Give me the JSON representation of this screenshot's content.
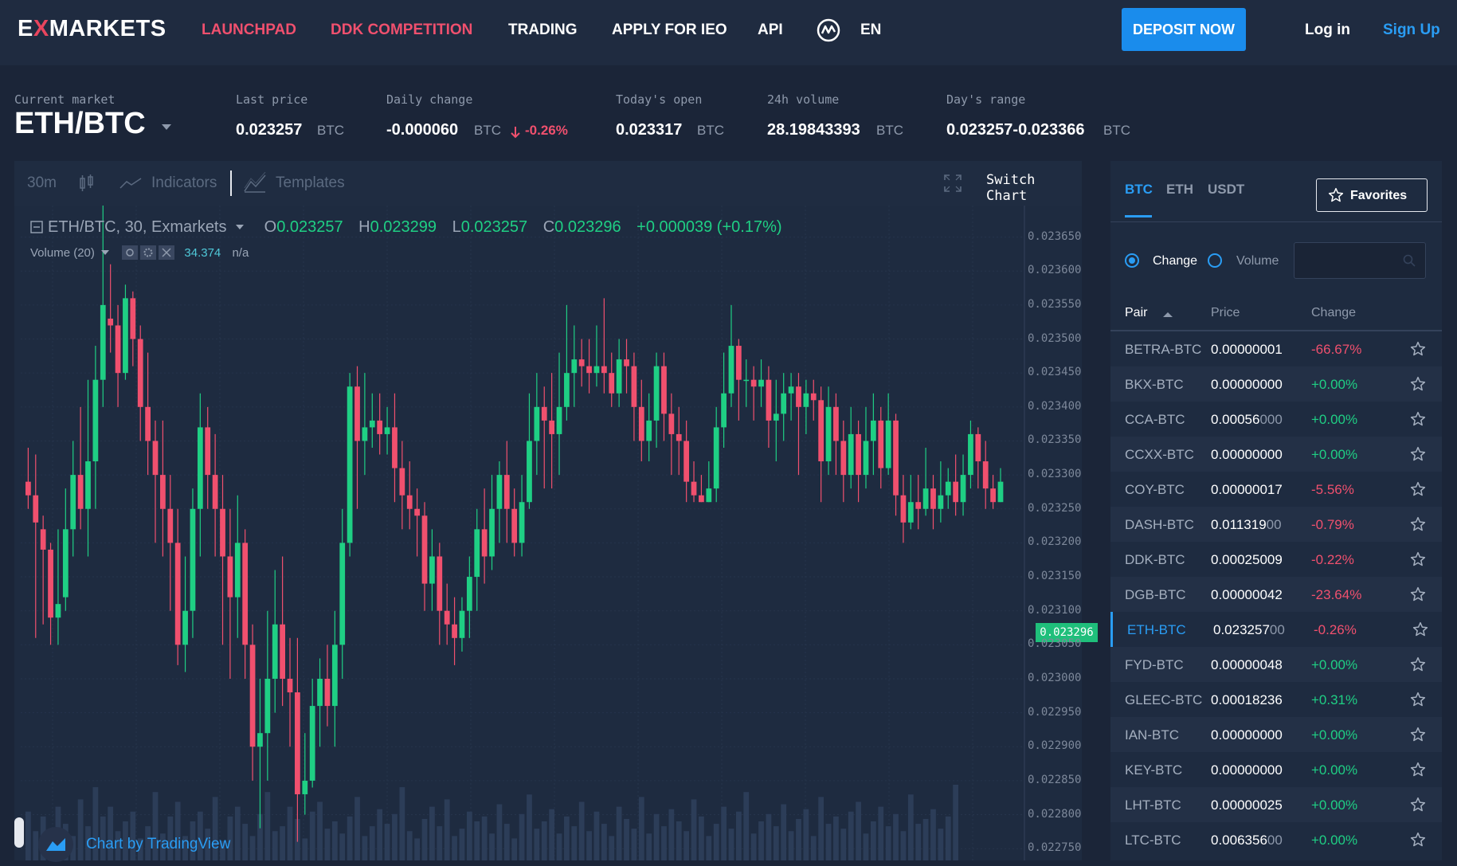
{
  "nav": {
    "logo_pre": "E",
    "logo_x": "X",
    "logo_post": "MARKETS",
    "launchpad": "LAUNCHPAD",
    "ddk": "DDK COMPETITION",
    "trading": "TRADING",
    "ieo": "APPLY FOR IEO",
    "api": "API",
    "lang": "EN",
    "deposit": "DEPOSIT NOW",
    "login": "Log in",
    "signup": "Sign Up"
  },
  "market": {
    "current_label": "Current market",
    "pair": "ETH/BTC",
    "last_price_label": "Last price",
    "last_price": "0.023257",
    "last_price_unit": "BTC",
    "daily_change_label": "Daily change",
    "daily_change": "-0.000060",
    "daily_change_unit": "BTC",
    "daily_change_pct": "-0.26%",
    "open_label": "Today's open",
    "open": "0.023317",
    "open_unit": "BTC",
    "volume_label": "24h volume",
    "volume": "28.19843393",
    "volume_unit": "BTC",
    "range_label": "Day's range",
    "range": "0.023257-0.023366",
    "range_unit": "BTC"
  },
  "toolbar": {
    "interval": "30m",
    "indicators": "Indicators",
    "templates": "Templates",
    "switch_chart": "Switch Chart"
  },
  "legend": {
    "title": "ETH/BTC, 30, Exmarkets",
    "o_label": "O",
    "o": "0.023257",
    "h_label": "H",
    "h": "0.023299",
    "l_label": "L",
    "l": "0.023257",
    "c_label": "C",
    "c": "0.023296",
    "change": "+0.000039 (+0.17%)",
    "volume_label": "Volume (20)",
    "volume_value": "34.374",
    "volume_na": "n/a",
    "last_tag": "0.023296",
    "tv_text": "Chart by TradingView"
  },
  "chart_data": {
    "type": "candlestick",
    "yticks": [
      "0.023650",
      "0.023600",
      "0.023550",
      "0.023500",
      "0.023450",
      "0.023400",
      "0.023350",
      "0.023300",
      "0.023250",
      "0.023200",
      "0.023150",
      "0.023100",
      "0.023050",
      "0.023000",
      "0.022950",
      "0.022900",
      "0.022850",
      "0.022800",
      "0.022750"
    ],
    "ylim": [
      0.022735,
      0.02368
    ],
    "candles": [
      [
        0.02329,
        0.02327,
        0.02334,
        0.02325
      ],
      [
        0.02327,
        0.02323,
        0.02333,
        0.02306
      ],
      [
        0.02322,
        0.02319,
        0.02324,
        0.02308
      ],
      [
        0.02319,
        0.02309,
        0.0232,
        0.02305
      ],
      [
        0.02309,
        0.02311,
        0.02322,
        0.02305
      ],
      [
        0.02312,
        0.02322,
        0.02328,
        0.0231
      ],
      [
        0.02322,
        0.0233,
        0.02335,
        0.02318
      ],
      [
        0.0233,
        0.02325,
        0.0234,
        0.02322
      ],
      [
        0.02325,
        0.02332,
        0.02344,
        0.02318
      ],
      [
        0.02332,
        0.02344,
        0.02349,
        0.02325
      ],
      [
        0.02344,
        0.02355,
        0.02562,
        0.0234
      ],
      [
        0.02353,
        0.02352,
        0.02361,
        0.02348
      ],
      [
        0.02352,
        0.02345,
        0.02355,
        0.0234
      ],
      [
        0.02345,
        0.02356,
        0.02358,
        0.02344
      ],
      [
        0.02356,
        0.0235,
        0.02357,
        0.02346
      ],
      [
        0.0235,
        0.0234,
        0.02352,
        0.02335
      ],
      [
        0.0234,
        0.02335,
        0.02348,
        0.0233
      ],
      [
        0.02335,
        0.0233,
        0.02338,
        0.0232
      ],
      [
        0.0233,
        0.02325,
        0.02338,
        0.02318
      ],
      [
        0.02325,
        0.0232,
        0.0233,
        0.0231
      ],
      [
        0.0232,
        0.02305,
        0.02325,
        0.02302
      ],
      [
        0.02305,
        0.0231,
        0.02318,
        0.02301
      ],
      [
        0.0231,
        0.02325,
        0.02328,
        0.02306
      ],
      [
        0.02325,
        0.02337,
        0.02342,
        0.02318
      ],
      [
        0.02337,
        0.0233,
        0.0234,
        0.02325
      ],
      [
        0.0233,
        0.02325,
        0.02336,
        0.02318
      ],
      [
        0.02325,
        0.02318,
        0.0233,
        0.02305
      ],
      [
        0.02318,
        0.02312,
        0.02325,
        0.023
      ],
      [
        0.02312,
        0.0232,
        0.02327,
        0.02306
      ],
      [
        0.0232,
        0.02305,
        0.02322,
        0.023
      ],
      [
        0.02305,
        0.0229,
        0.02308,
        0.02285
      ],
      [
        0.0229,
        0.02292,
        0.023,
        0.02278
      ],
      [
        0.02292,
        0.023,
        0.0231,
        0.02285
      ],
      [
        0.023,
        0.02308,
        0.02316,
        0.02295
      ],
      [
        0.02308,
        0.023,
        0.02318,
        0.02296
      ],
      [
        0.023,
        0.02298,
        0.02306,
        0.0229
      ],
      [
        0.02298,
        0.02283,
        0.02306,
        0.02276
      ],
      [
        0.02283,
        0.02285,
        0.02292,
        0.0228
      ],
      [
        0.02285,
        0.02296,
        0.023,
        0.02284
      ],
      [
        0.02296,
        0.023,
        0.02303,
        0.0229
      ],
      [
        0.023,
        0.02296,
        0.02305,
        0.02293
      ],
      [
        0.02296,
        0.02305,
        0.0231,
        0.0229
      ],
      [
        0.02305,
        0.0232,
        0.02325,
        0.023
      ],
      [
        0.0232,
        0.02343,
        0.02345,
        0.02318
      ],
      [
        0.02343,
        0.02335,
        0.02346,
        0.02325
      ],
      [
        0.02335,
        0.02337,
        0.02345,
        0.0233
      ],
      [
        0.02337,
        0.02338,
        0.02342,
        0.02334
      ],
      [
        0.02338,
        0.02336,
        0.02342,
        0.02333
      ],
      [
        0.02336,
        0.02337,
        0.0234,
        0.02333
      ],
      [
        0.02337,
        0.02331,
        0.02342,
        0.02326
      ],
      [
        0.02331,
        0.02327,
        0.02335,
        0.02322
      ],
      [
        0.02327,
        0.02325,
        0.02332,
        0.02322
      ],
      [
        0.02325,
        0.02324,
        0.02328,
        0.02318
      ],
      [
        0.02324,
        0.02314,
        0.02326,
        0.0231
      ],
      [
        0.02314,
        0.02318,
        0.02322,
        0.0231
      ],
      [
        0.02318,
        0.0231,
        0.0232,
        0.02305
      ],
      [
        0.0231,
        0.02308,
        0.02314,
        0.02305
      ],
      [
        0.02308,
        0.02306,
        0.02312,
        0.02302
      ],
      [
        0.02306,
        0.0231,
        0.02312,
        0.02304
      ],
      [
        0.0231,
        0.02315,
        0.02318,
        0.02306
      ],
      [
        0.02315,
        0.02322,
        0.02325,
        0.0231
      ],
      [
        0.02322,
        0.02318,
        0.02328,
        0.02314
      ],
      [
        0.02318,
        0.02325,
        0.0233,
        0.02316
      ],
      [
        0.02325,
        0.0233,
        0.02332,
        0.0232
      ],
      [
        0.0233,
        0.02325,
        0.02335,
        0.0232
      ],
      [
        0.02325,
        0.0232,
        0.02328,
        0.02318
      ],
      [
        0.0232,
        0.02326,
        0.0233,
        0.02318
      ],
      [
        0.02326,
        0.02335,
        0.02342,
        0.02325
      ],
      [
        0.02335,
        0.0234,
        0.02345,
        0.0233
      ],
      [
        0.0234,
        0.02338,
        0.02343,
        0.02328
      ],
      [
        0.02338,
        0.02336,
        0.02345,
        0.02328
      ],
      [
        0.02336,
        0.0234,
        0.02348,
        0.0233
      ],
      [
        0.0234,
        0.02345,
        0.02355,
        0.02338
      ],
      [
        0.02345,
        0.02347,
        0.02352,
        0.0234
      ],
      [
        0.02347,
        0.02346,
        0.0235,
        0.02343
      ],
      [
        0.02346,
        0.02345,
        0.0235,
        0.02342
      ],
      [
        0.02345,
        0.02346,
        0.02352,
        0.02343
      ],
      [
        0.02346,
        0.02345,
        0.02356,
        0.02342
      ],
      [
        0.02345,
        0.02342,
        0.02348,
        0.0234
      ],
      [
        0.02342,
        0.02347,
        0.0235,
        0.0234
      ],
      [
        0.02347,
        0.02346,
        0.0235,
        0.02342
      ],
      [
        0.02346,
        0.0234,
        0.02348,
        0.02335
      ],
      [
        0.0234,
        0.02335,
        0.02344,
        0.02332
      ],
      [
        0.02335,
        0.02338,
        0.02342,
        0.02332
      ],
      [
        0.02338,
        0.02346,
        0.02348,
        0.02334
      ],
      [
        0.02346,
        0.02339,
        0.02348,
        0.02335
      ],
      [
        0.02339,
        0.02336,
        0.02342,
        0.0233
      ],
      [
        0.02336,
        0.02335,
        0.0234,
        0.0233
      ],
      [
        0.02335,
        0.02329,
        0.02338,
        0.02326
      ],
      [
        0.02329,
        0.02327,
        0.02332,
        0.02326
      ],
      [
        0.02327,
        0.02326,
        0.0233,
        0.02326
      ],
      [
        0.02326,
        0.02328,
        0.02332,
        0.02326
      ],
      [
        0.02328,
        0.02337,
        0.0234,
        0.02326
      ],
      [
        0.02337,
        0.02342,
        0.02348,
        0.02334
      ],
      [
        0.02342,
        0.02349,
        0.02355,
        0.0234
      ],
      [
        0.02349,
        0.02344,
        0.0235,
        0.02338
      ],
      [
        0.02344,
        0.02344,
        0.02347,
        0.0234
      ],
      [
        0.02344,
        0.02343,
        0.02346,
        0.02338
      ],
      [
        0.02343,
        0.02344,
        0.02347,
        0.0234
      ],
      [
        0.02344,
        0.02338,
        0.02346,
        0.02334
      ],
      [
        0.02338,
        0.02339,
        0.02344,
        0.02332
      ],
      [
        0.02339,
        0.02342,
        0.02345,
        0.02335
      ],
      [
        0.02342,
        0.02343,
        0.02345,
        0.02338
      ],
      [
        0.02343,
        0.0234,
        0.02345,
        0.0233
      ],
      [
        0.0234,
        0.02342,
        0.02344,
        0.02336
      ],
      [
        0.02342,
        0.02341,
        0.02344,
        0.02338
      ],
      [
        0.02341,
        0.02332,
        0.02343,
        0.02326
      ],
      [
        0.02332,
        0.0234,
        0.02343,
        0.0233
      ],
      [
        0.0234,
        0.02335,
        0.02342,
        0.0233
      ],
      [
        0.02335,
        0.0233,
        0.02338,
        0.02326
      ],
      [
        0.0233,
        0.02336,
        0.0234,
        0.02328
      ],
      [
        0.02336,
        0.0233,
        0.02338,
        0.02326
      ],
      [
        0.0233,
        0.02335,
        0.0234,
        0.02328
      ],
      [
        0.02335,
        0.02338,
        0.02342,
        0.0233
      ],
      [
        0.02338,
        0.02331,
        0.0234,
        0.02328
      ],
      [
        0.02331,
        0.02338,
        0.02342,
        0.0233
      ],
      [
        0.02338,
        0.02327,
        0.02339,
        0.02324
      ],
      [
        0.02327,
        0.02323,
        0.0233,
        0.0232
      ],
      [
        0.02323,
        0.02326,
        0.0233,
        0.02322
      ],
      [
        0.02326,
        0.02325,
        0.0233,
        0.02322
      ],
      [
        0.02325,
        0.02328,
        0.02334,
        0.02324
      ],
      [
        0.02328,
        0.02325,
        0.0233,
        0.02322
      ],
      [
        0.02325,
        0.02327,
        0.02332,
        0.02323
      ],
      [
        0.02327,
        0.02329,
        0.02331,
        0.02325
      ],
      [
        0.02329,
        0.02326,
        0.02333,
        0.02324
      ],
      [
        0.02326,
        0.0233,
        0.02333,
        0.02324
      ],
      [
        0.0233,
        0.02336,
        0.02338,
        0.02328
      ],
      [
        0.02336,
        0.02332,
        0.02337,
        0.02328
      ],
      [
        0.02332,
        0.02328,
        0.02335,
        0.02325
      ],
      [
        0.02328,
        0.02326,
        0.0233,
        0.02325
      ],
      [
        0.02326,
        0.02329,
        0.02331,
        0.02326
      ]
    ],
    "volumes": [
      20,
      12,
      18,
      8,
      22,
      15,
      10,
      25,
      14,
      30,
      18,
      22,
      12,
      16,
      20,
      9,
      14,
      28,
      11,
      18,
      24,
      10,
      16,
      20,
      13,
      26,
      8,
      18,
      22,
      15,
      10,
      19,
      28,
      12,
      14,
      22,
      17,
      9,
      20,
      24,
      13,
      16,
      11,
      18,
      26,
      10,
      14,
      21,
      15,
      19,
      30,
      12,
      9,
      17,
      22,
      14,
      25,
      10,
      13,
      20,
      16,
      18,
      11,
      23,
      15,
      9,
      19,
      27,
      13,
      16,
      21,
      11,
      18,
      14,
      24,
      12,
      20,
      15,
      10,
      22,
      17,
      13,
      26,
      11,
      19,
      14,
      21,
      16,
      12,
      25,
      18,
      10,
      15,
      22,
      13,
      20,
      28,
      11,
      16,
      19,
      14,
      23,
      12,
      17,
      21,
      10,
      26,
      15,
      18,
      13,
      20,
      24,
      11,
      16,
      22,
      14,
      19,
      12,
      27,
      15,
      17,
      21,
      13,
      18,
      31
    ]
  },
  "pairs": {
    "tab_btc": "BTC",
    "tab_eth": "ETH",
    "tab_usdt": "USDT",
    "favorites": "Favorites",
    "radio_change": "Change",
    "radio_volume": "Volume",
    "col_pair": "Pair",
    "col_price": "Price",
    "col_change": "Change",
    "rows": [
      {
        "pair": "BETRA-BTC",
        "price_main": "0.00000001",
        "price_dim": "",
        "change": "-66.67%",
        "dir": "neg"
      },
      {
        "pair": "BKX-BTC",
        "price_main": "0.00000000",
        "price_dim": "",
        "change": "+0.00%",
        "dir": "pos"
      },
      {
        "pair": "CCA-BTC",
        "price_main": "0.00056",
        "price_dim": "000",
        "change": "+0.00%",
        "dir": "pos"
      },
      {
        "pair": "CCXX-BTC",
        "price_main": "0.00000000",
        "price_dim": "",
        "change": "+0.00%",
        "dir": "pos"
      },
      {
        "pair": "COY-BTC",
        "price_main": "0.00000017",
        "price_dim": "",
        "change": "-5.56%",
        "dir": "neg"
      },
      {
        "pair": "DASH-BTC",
        "price_main": "0.011319",
        "price_dim": "00",
        "change": "-0.79%",
        "dir": "neg"
      },
      {
        "pair": "DDK-BTC",
        "price_main": "0.00025009",
        "price_dim": "",
        "change": "-0.22%",
        "dir": "neg"
      },
      {
        "pair": "DGB-BTC",
        "price_main": "0.00000042",
        "price_dim": "",
        "change": "-23.64%",
        "dir": "neg"
      },
      {
        "pair": "ETH-BTC",
        "price_main": "0.023257",
        "price_dim": "00",
        "change": "-0.26%",
        "dir": "neg",
        "active": true
      },
      {
        "pair": "FYD-BTC",
        "price_main": "0.00000048",
        "price_dim": "",
        "change": "+0.00%",
        "dir": "pos"
      },
      {
        "pair": "GLEEC-BTC",
        "price_main": "0.00018236",
        "price_dim": "",
        "change": "+0.31%",
        "dir": "pos"
      },
      {
        "pair": "IAN-BTC",
        "price_main": "0.00000000",
        "price_dim": "",
        "change": "+0.00%",
        "dir": "pos"
      },
      {
        "pair": "KEY-BTC",
        "price_main": "0.00000000",
        "price_dim": "",
        "change": "+0.00%",
        "dir": "pos"
      },
      {
        "pair": "LHT-BTC",
        "price_main": "0.00000025",
        "price_dim": "",
        "change": "+0.00%",
        "dir": "pos"
      },
      {
        "pair": "LTC-BTC",
        "price_main": "0.006356",
        "price_dim": "00",
        "change": "+0.00%",
        "dir": "pos"
      }
    ]
  },
  "colors": {
    "up": "#1fcf84",
    "down": "#f0506e",
    "accent": "#2a9df4",
    "bg": "#1b2538"
  },
  "icons": {
    "coinmarketcap": "coinmarketcap-icon",
    "star": "star-icon",
    "search": "search-icon",
    "expand": "expand-icon",
    "tradingview": "tradingview-icon"
  }
}
